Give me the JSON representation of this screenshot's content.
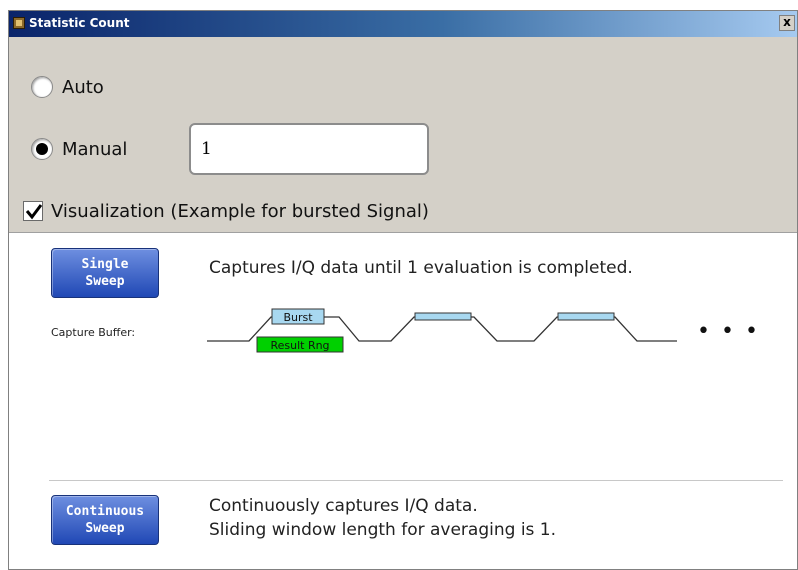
{
  "window": {
    "title": "Statistic Count",
    "close_glyph": "x"
  },
  "mode": {
    "auto_label": "Auto",
    "manual_label": "Manual",
    "selected": "Manual",
    "manual_value": "1"
  },
  "visualization": {
    "checkbox_label": "Visualization (Example for bursted Signal)",
    "checked": true
  },
  "single_sweep": {
    "button_label": "Single\nSweep",
    "description": "Captures I/Q data until 1 evaluation is completed.",
    "capture_buffer_label": "Capture Buffer:",
    "burst_label": "Burst",
    "result_range_label": "Result Rng",
    "ellipsis": "• • •"
  },
  "continuous_sweep": {
    "button_label": "Continuous\nSweep",
    "description_line1": "Continuously captures I/Q data.",
    "description_line2": "Sliding window length for averaging is 1."
  },
  "colors": {
    "burst_fill": "#a8d8f0",
    "result_range_fill": "#00d000",
    "button_blue": "#2048b5",
    "title_bar": "#0a246a"
  }
}
